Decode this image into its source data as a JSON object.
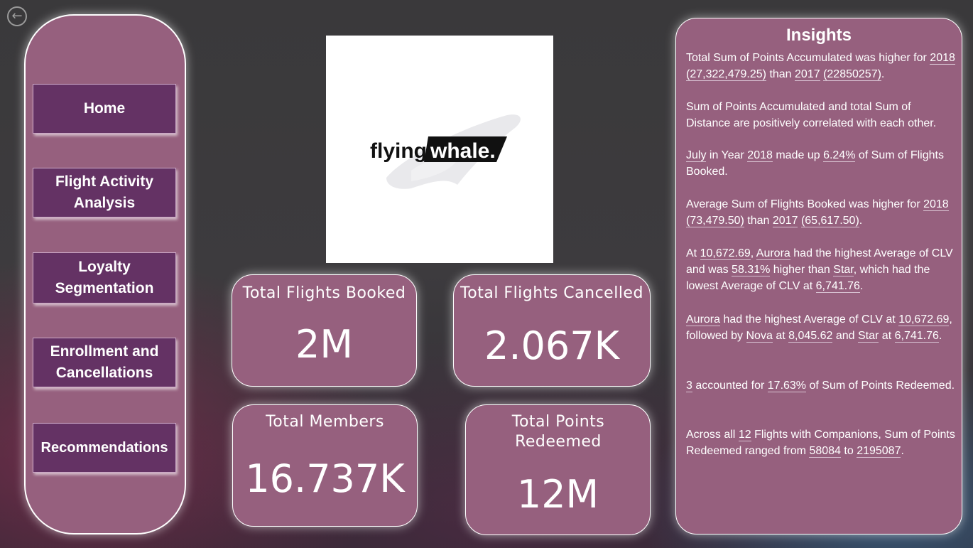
{
  "nav": {
    "back_icon": "arrow-left-icon",
    "items": [
      {
        "label": "Home"
      },
      {
        "label": "Flight Activity Analysis"
      },
      {
        "label": "Loyalty Segmentation"
      },
      {
        "label": "Enrollment and Cancellations"
      },
      {
        "label": "Recommendations"
      }
    ]
  },
  "logo": {
    "text_left": "flying",
    "text_right": "whale."
  },
  "kpis": [
    {
      "title": "Total Flights Booked",
      "value": "2M"
    },
    {
      "title": "Total Flights Cancelled",
      "value": "2.067K"
    },
    {
      "title": "Total Members",
      "value": "16.737K"
    },
    {
      "title": "Total Points Redeemed",
      "value": "12M"
    }
  ],
  "insights": {
    "title": "Insights",
    "p1": {
      "a": "Total Sum of Points Accumulated was higher for",
      "b": "2018",
      "c": "(27,322,479.25)",
      "d": "than",
      "e": "2017",
      "f": "(22850257)",
      "g": "."
    },
    "p2": {
      "a": "Sum of Points Accumulated and total Sum of Distance are positively correlated with each other."
    },
    "p3": {
      "a": "July",
      "b": "in Year",
      "c": "2018",
      "d": "made up",
      "e": "6.24%",
      "f": "of Sum of Flights Booked."
    },
    "p4": {
      "a": "Average Sum of Flights Booked was higher for",
      "b": "2018",
      "c": "(73,479.50)",
      "d": "than",
      "e": "2017",
      "f": "(65,617.50)",
      "g": "."
    },
    "p5": {
      "a": "At",
      "b": "10,672.69",
      "c": ",",
      "d": "Aurora",
      "e": "had the highest Average of CLV and was",
      "f": "58.31%",
      "g": "higher than",
      "h": "Star",
      "i": ", which had the lowest Average of CLV at",
      "j": "6,741.76",
      "k": "."
    },
    "p6": {
      "a": "Aurora",
      "b": "had the highest Average of CLV at",
      "c": "10,672.69",
      "d": ", followed by",
      "e": "Nova",
      "f": "at",
      "g": "8,045.62",
      "h": "and",
      "i": "Star",
      "j": "at",
      "k": "6,741.76",
      "l": "."
    },
    "p7": {
      "a": "3",
      "b": "accounted for",
      "c": "17.63%",
      "d": "of Sum of Points Redeemed."
    },
    "p8": {
      "a": "Across all",
      "b": "12",
      "c": "Flights with Companions, Sum of Points Redeemed ranged from",
      "d": "58084",
      "e": "to",
      "f": "2195087",
      "g": "."
    }
  }
}
